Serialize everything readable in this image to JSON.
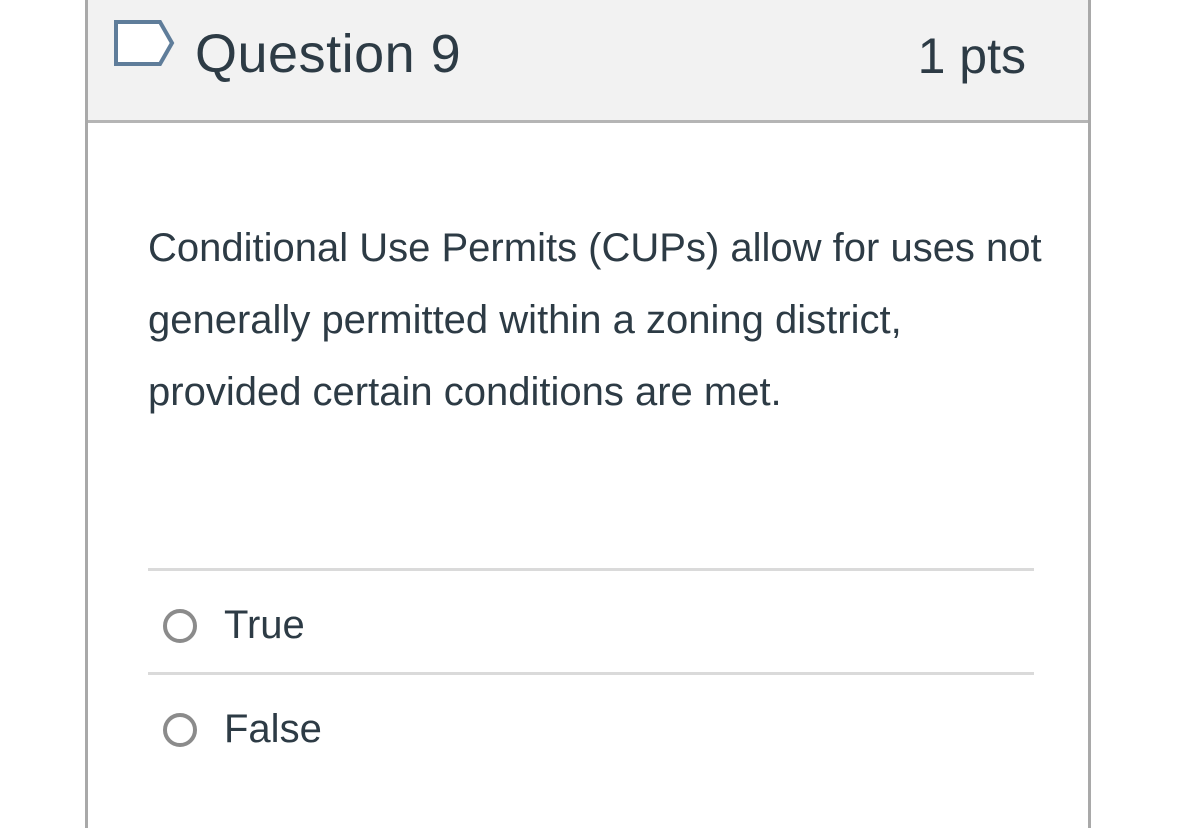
{
  "question": {
    "title": "Question 9",
    "points": "1 pts",
    "text": "Conditional Use Permits (CUPs) allow for uses not generally permitted within a zoning district, provided certain conditions are met.",
    "flag_icon": "flag-outline-icon"
  },
  "answers": [
    {
      "label": "True",
      "selected": false
    },
    {
      "label": "False",
      "selected": false
    }
  ],
  "colors": {
    "text": "#2d3b45",
    "header_bg": "#f2f2f2",
    "border": "#a9a9a9",
    "divider": "#dadada",
    "flag_stroke": "#5f7d9a",
    "radio_border": "#8b8b8b"
  }
}
